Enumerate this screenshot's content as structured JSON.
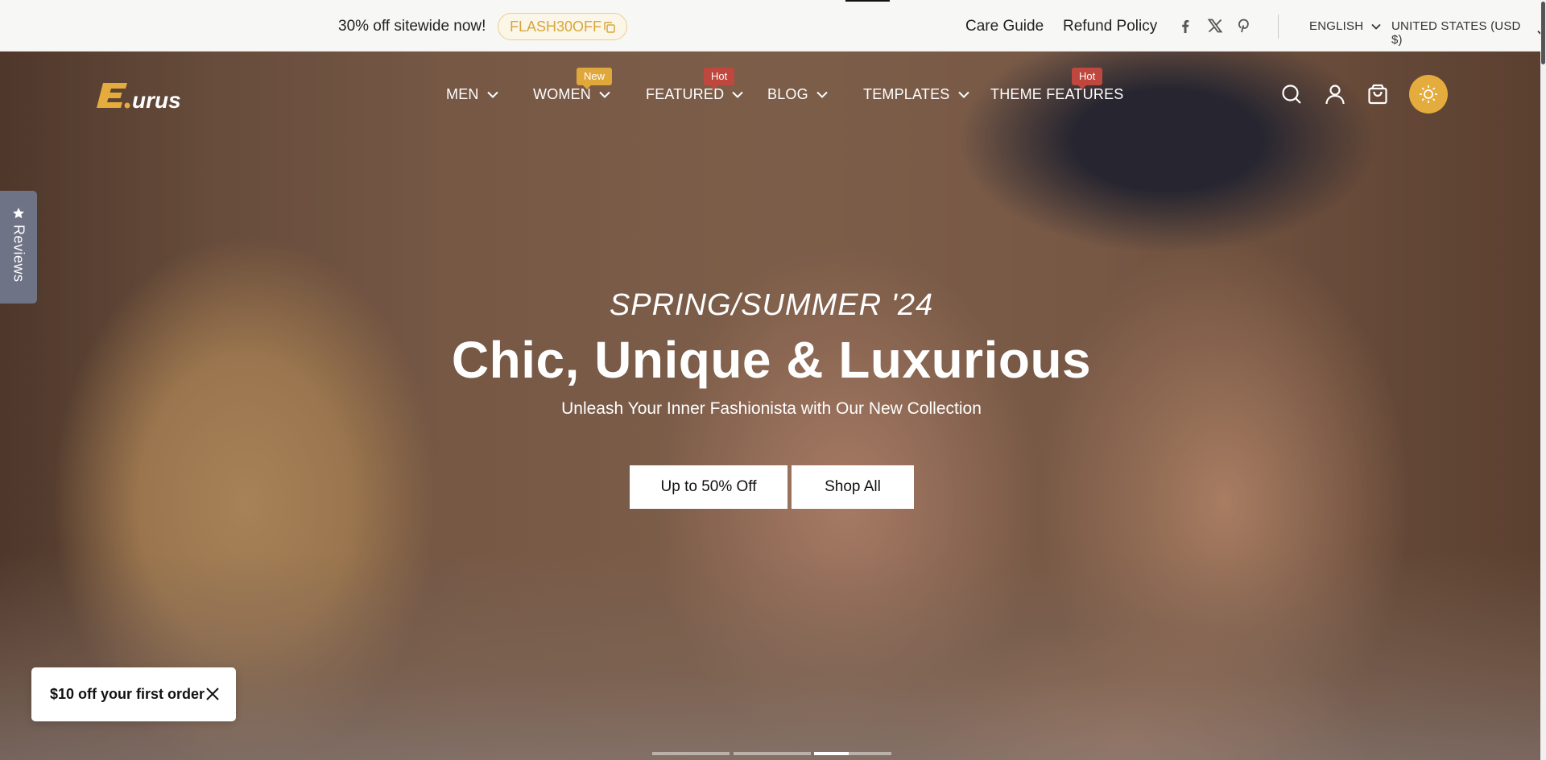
{
  "topbar": {
    "promo_text": "30% off sitewide now!",
    "promo_code": "FLASH30OFF",
    "links": [
      "Care Guide",
      "Refund Policy"
    ],
    "social_icons": [
      "facebook-icon",
      "x-twitter-icon",
      "pinterest-icon"
    ],
    "language": "ENGLISH",
    "currency": "UNITED STATES (USD $)"
  },
  "header": {
    "logo_text": "E.urus",
    "nav": [
      {
        "label": "MEN",
        "badge": ""
      },
      {
        "label": "WOMEN",
        "badge": "New"
      },
      {
        "label": "FEATURED",
        "badge": "Hot"
      },
      {
        "label": "BLOG",
        "badge": ""
      },
      {
        "label": "TEMPLATES",
        "badge": ""
      },
      {
        "label": "THEME FEATURES",
        "badge": "Hot"
      }
    ],
    "icons": [
      "search-icon",
      "account-icon",
      "cart-icon",
      "sun-icon"
    ]
  },
  "reviews_tab": {
    "label": "Reviews",
    "icon": "star-icon"
  },
  "hero": {
    "eyebrow": "SPRING/SUMMER '24",
    "headline": "Chic, Unique & Luxurious",
    "subline": "Unleash Your Inner Fashionista with Our New Collection",
    "cta_sale": "Up to 50% Off",
    "cta_all": "Shop All",
    "slides_total": 3,
    "active_slide": 3,
    "active_slide_progress": 0.45
  },
  "popup": {
    "text": "$10 off your first order",
    "icon": "close-icon"
  },
  "colors": {
    "accent": "#e4ac3c",
    "badge_new": "#e0a73b",
    "badge_hot": "#c0473d",
    "promo_code": "#d7a63a"
  }
}
